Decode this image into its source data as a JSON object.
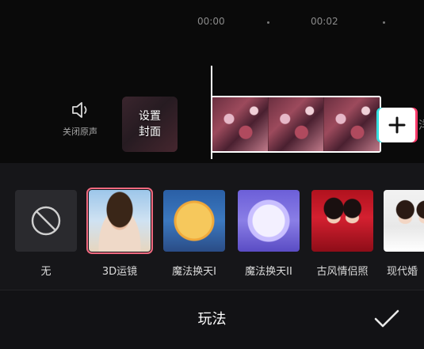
{
  "timeline": {
    "ruler_marks": [
      "00:00",
      "00:02"
    ],
    "mute_label": "关闭原声",
    "cover_label_line1": "设置",
    "cover_label_line2": "封面",
    "edge_glyph": "洋"
  },
  "effects": {
    "items": [
      {
        "label": "无",
        "icon": "no-symbol-icon",
        "selected": false
      },
      {
        "label": "3D运镜",
        "icon": "portrait-thumbnail",
        "selected": true
      },
      {
        "label": "魔法换天Ⅰ",
        "icon": "full-moon-thumbnail",
        "selected": false
      },
      {
        "label": "魔法换天II",
        "icon": "purple-moon-thumbnail",
        "selected": false
      },
      {
        "label": "古风情侣照",
        "icon": "ancient-couple-thumbnail",
        "selected": false
      },
      {
        "label": "现代婚",
        "icon": "wedding-thumbnail",
        "selected": false
      }
    ]
  },
  "bottom": {
    "title": "玩法"
  },
  "colors": {
    "selected_outline": "#f0697f",
    "add_button_left_glow": "#35e0e0",
    "add_button_right_glow": "#ff3b6b"
  }
}
